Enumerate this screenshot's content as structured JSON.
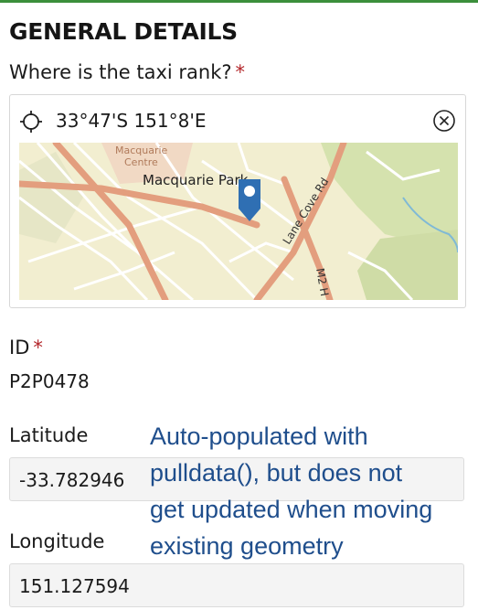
{
  "section": {
    "title": "GENERAL DETAILS"
  },
  "location": {
    "label": "Where is the taxi rank?",
    "required_mark": "*",
    "coordinates": "33°47'S 151°8'E",
    "map": {
      "poi_label": "Macquarie Centre",
      "poi_label_line1": "Macquarie",
      "poi_label_line2": "Centre",
      "place_label": "Macquarie Park",
      "road_label_1": "Lane Cove Rd",
      "road_label_2": "M2 H"
    }
  },
  "id_field": {
    "label": "ID",
    "required_mark": "*",
    "value": "P2P0478"
  },
  "latitude": {
    "label": "Latitude",
    "value": "-33.782946"
  },
  "longitude": {
    "label": "Longitude",
    "value": "151.127594"
  },
  "annotation": {
    "lines": [
      "Auto-populated with",
      "pulldata(), but does not",
      "get updated when moving",
      "existing geometry"
    ],
    "color": "#1f4e8c"
  },
  "colors": {
    "accent": "#3c8f3c",
    "required": "#b3262a",
    "pin": "#2f6fb3"
  },
  "icons": {
    "locate": "crosshair-icon",
    "clear": "close-circle-icon",
    "pin": "map-pin-icon"
  }
}
